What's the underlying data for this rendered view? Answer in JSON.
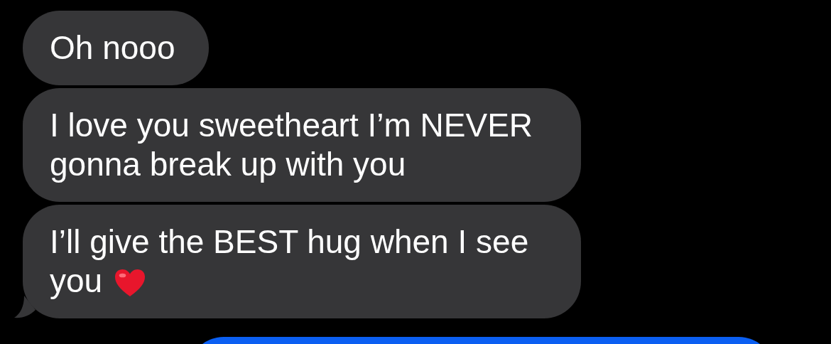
{
  "messages": [
    {
      "kind": "received",
      "text": "Oh nooo",
      "tail": false,
      "heart": false
    },
    {
      "kind": "received",
      "text": "I love you sweetheart I’m NEVER gonna break up with you",
      "tail": false,
      "heart": false
    },
    {
      "kind": "received",
      "text": "I’ll give the BEST hug when I see you",
      "tail": true,
      "heart": true
    },
    {
      "kind": "sent"
    }
  ]
}
